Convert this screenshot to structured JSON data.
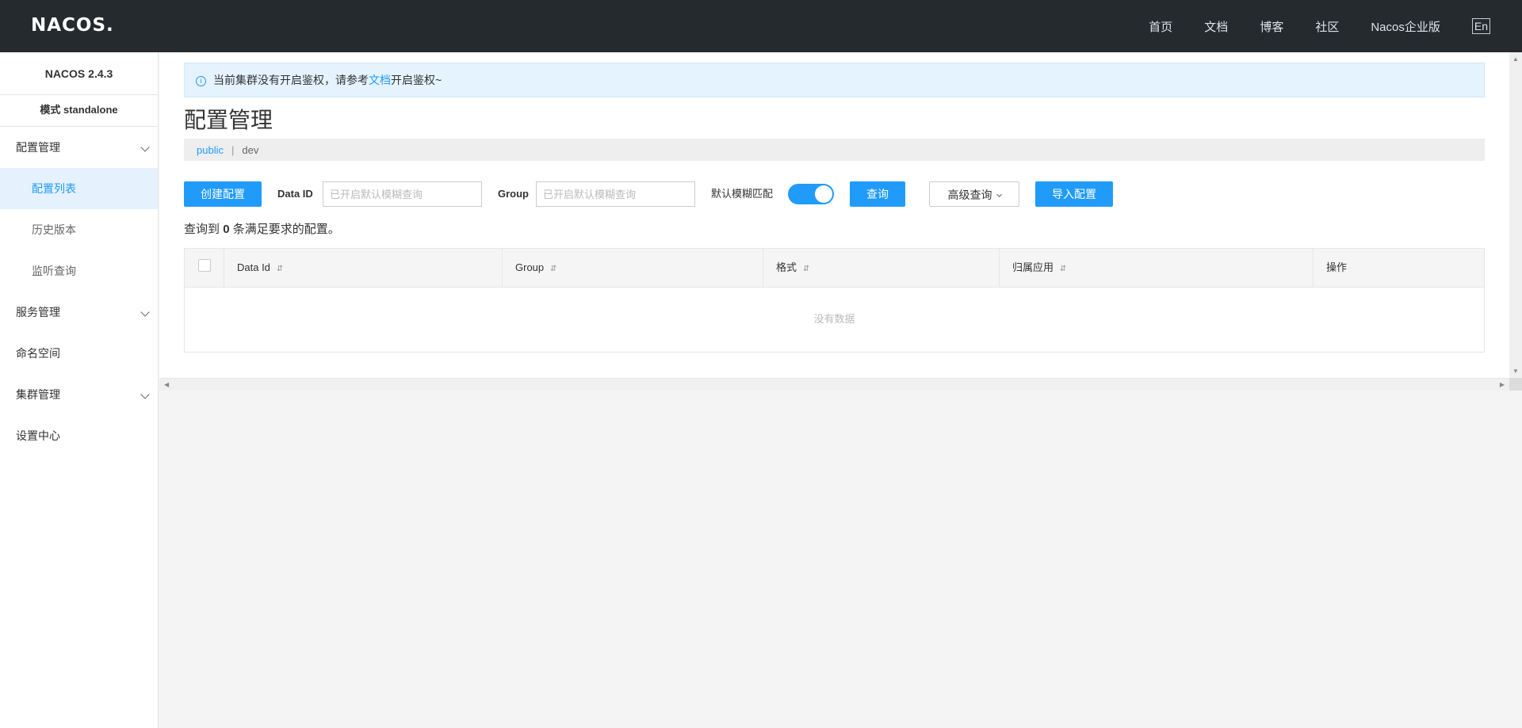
{
  "header": {
    "logo": "NACOS.",
    "nav": [
      "首页",
      "文档",
      "博客",
      "社区",
      "Nacos企业版"
    ],
    "lang_toggle": "En"
  },
  "sidebar": {
    "version": "NACOS 2.4.3",
    "mode": "模式 standalone",
    "groups": [
      {
        "label": "配置管理",
        "items": [
          "配置列表",
          "历史版本",
          "监听查询"
        ]
      },
      {
        "label": "服务管理"
      },
      {
        "label": "命名空间"
      },
      {
        "label": "集群管理"
      },
      {
        "label": "设置中心"
      }
    ]
  },
  "alert": {
    "prefix": "当前集群没有开启鉴权，请参考",
    "link": "文档",
    "suffix": "开启鉴权~"
  },
  "page": {
    "title": "配置管理"
  },
  "namespaces": {
    "active": "public",
    "separator": "|",
    "other": "dev"
  },
  "toolbar": {
    "create_label": "创建配置",
    "data_id_label": "Data ID",
    "data_id_placeholder": "已开启默认模糊查询",
    "group_label": "Group",
    "group_placeholder": "已开启默认模糊查询",
    "fuzzy_label": "默认模糊匹配",
    "fuzzy_enabled": true,
    "query_label": "查询",
    "advanced_label": "高级查询",
    "import_label": "导入配置"
  },
  "result": {
    "prefix": "查询到",
    "count": "0",
    "suffix": "条满足要求的配置。"
  },
  "table": {
    "columns": [
      "Data Id",
      "Group",
      "格式",
      "归属应用",
      "操作"
    ],
    "sort_glyph": "⇵",
    "empty_text": "没有数据"
  }
}
